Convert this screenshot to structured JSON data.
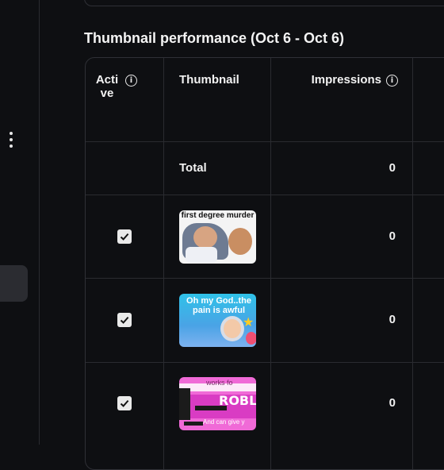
{
  "section": {
    "title": "Thumbnail performance (Oct 6 - Oct 6)"
  },
  "table": {
    "headers": {
      "active": "Active",
      "thumbnail": "Thumbnail",
      "impressions": "Impressions"
    },
    "total": {
      "label": "Total",
      "impressions": "0"
    },
    "rows": [
      {
        "active": true,
        "thumb_caption": "first degree murder",
        "impressions": "0"
      },
      {
        "active": true,
        "thumb_caption": "Oh my God..the pain is awful",
        "impressions": "0"
      },
      {
        "active": true,
        "thumb_caption_top": "works fo",
        "thumb_logo": "ROBLO",
        "thumb_caption_bottom": "And can give y",
        "impressions": "0"
      }
    ]
  },
  "icons": {
    "info": "info-icon",
    "menu": "more-vert-icon",
    "check": "check-icon"
  },
  "colors": {
    "background": "#0e0f12",
    "border": "#2f3036",
    "text": "#f2f2f2",
    "checkbox": "#e9e9e9"
  }
}
